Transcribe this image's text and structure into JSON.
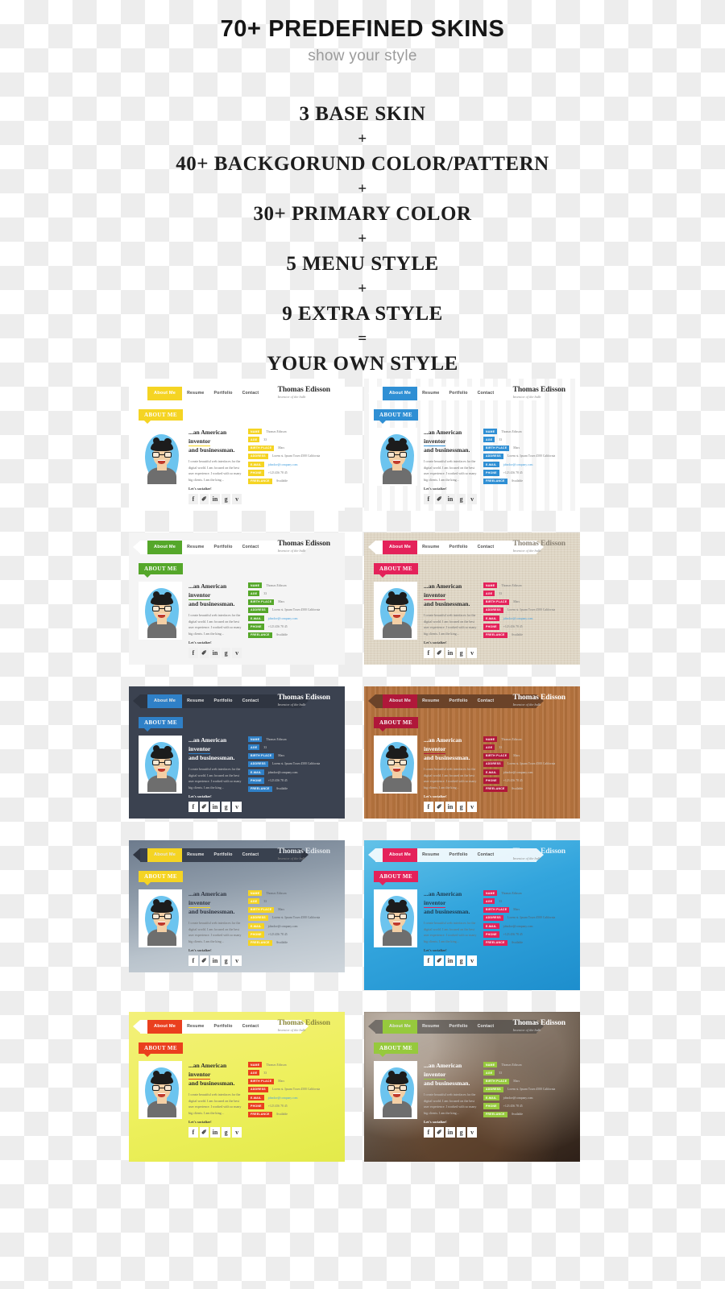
{
  "header": {
    "title": "70+ PREDEFINED SKINS",
    "subtitle": "show your style"
  },
  "formula": {
    "lines": [
      {
        "text": "3 BASE SKIN",
        "kind": "big"
      },
      {
        "text": "+",
        "kind": "op"
      },
      {
        "text": "40+ BACKGORUND COLOR/PATTERN",
        "kind": "wide"
      },
      {
        "text": "+",
        "kind": "op"
      },
      {
        "text": "30+ PRIMARY COLOR",
        "kind": "big"
      },
      {
        "text": "+",
        "kind": "op"
      },
      {
        "text": "5 MENU STYLE",
        "kind": "big"
      },
      {
        "text": "+",
        "kind": "op"
      },
      {
        "text": "9 EXTRA STYLE",
        "kind": "big"
      },
      {
        "text": "=",
        "kind": "op"
      },
      {
        "text": "YOUR OWN STYLE",
        "kind": "big"
      }
    ]
  },
  "card": {
    "nav": [
      "About Me",
      "Resume",
      "Portfolio",
      "Contact"
    ],
    "active_nav": "About Me",
    "brand_name": "Thomas Edisson",
    "brand_tagline": "Inventor of the bulb",
    "section_tag": "ABOUT ME",
    "headline_1": "...an American ",
    "headline_hl": "inventor",
    "headline_2": "and businessman.",
    "paragraph": "I create beautiful web interfaces for the digital world. I am focused on the best user experience. I worked with so many big clients. I am the king...",
    "socialize_label": "Let's socialize!",
    "socials": [
      {
        "name": "facebook-icon",
        "glyph": "f"
      },
      {
        "name": "twitter-icon",
        "glyph": "✐"
      },
      {
        "name": "linkedin-icon",
        "glyph": "in"
      },
      {
        "name": "google-plus-icon",
        "glyph": "g"
      },
      {
        "name": "vimeo-icon",
        "glyph": "v"
      }
    ],
    "details": [
      {
        "label": "NAME",
        "value": "Thomas Edisson",
        "mail": false
      },
      {
        "label": "AGE",
        "value": "33",
        "mail": false
      },
      {
        "label": "BIRTH PLACE",
        "value": "Mars",
        "mail": false
      },
      {
        "label": "ADDRESS",
        "value": "Lorem st. Ipsum Town 4500 California",
        "mail": false
      },
      {
        "label": "E-MAIL",
        "value": "johndoe@company.com",
        "mail": true
      },
      {
        "label": "PHONE",
        "value": "+123 456 78 45",
        "mail": false
      },
      {
        "label": "FREELANCE",
        "value": "Available",
        "mail": false
      }
    ]
  },
  "skins": [
    {
      "id": "yellow-white",
      "bg": "bg-white",
      "mod": "sk-white",
      "accent": "#f5d423",
      "ribbon": "",
      "tall": false
    },
    {
      "id": "blue-stripe",
      "bg": "bg-stripe",
      "mod": "sk-stripe",
      "accent": "#2f8fd4",
      "ribbon": "",
      "tall": false
    },
    {
      "id": "green-gray",
      "bg": "bg-lightgray",
      "mod": "sk-gray",
      "accent": "#55a72a",
      "ribbon": "",
      "tall": false
    },
    {
      "id": "pink-paper",
      "bg": "bg-paper",
      "mod": "sk-paper",
      "accent": "#e4225a",
      "ribbon": "",
      "tall": false
    },
    {
      "id": "blue-dark",
      "bg": "bg-dark",
      "mod": "sk-dark",
      "accent": "#2f80c7",
      "ribbon": "dark",
      "tall": false
    },
    {
      "id": "crimson-wood",
      "bg": "bg-wood",
      "mod": "sk-wood",
      "accent": "#b0173a",
      "ribbon": "woodrib",
      "tall": false
    },
    {
      "id": "yellow-slate",
      "bg": "bg-slate",
      "mod": "sk-slate",
      "accent": "#f5d423",
      "ribbon": "slaterib",
      "tall": false
    },
    {
      "id": "pink-bluegrad",
      "bg": "bg-bluegrad",
      "mod": "sk-bluegrad",
      "accent": "#e4225a",
      "ribbon": "transl",
      "tall": true
    },
    {
      "id": "red-lime",
      "bg": "bg-lime",
      "mod": "sk-lime",
      "accent": "#ea3f1e",
      "ribbon": "",
      "tall": true
    },
    {
      "id": "green-photo",
      "bg": "bg-photo",
      "mod": "sk-photo",
      "accent": "#96c93d",
      "ribbon": "photorib",
      "tall": true
    }
  ]
}
